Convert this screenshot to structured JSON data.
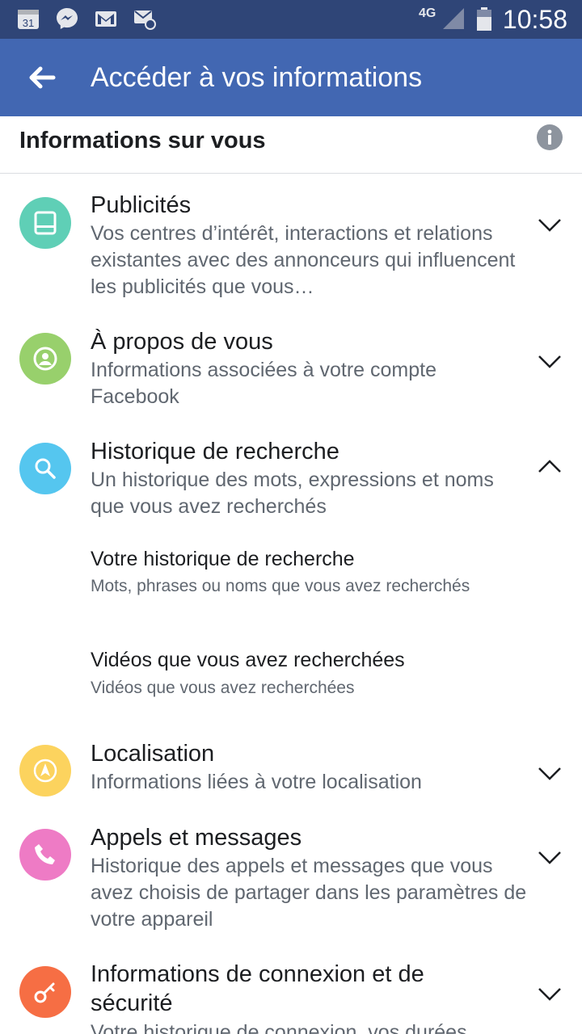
{
  "status_bar": {
    "time": "10:58",
    "network": "4G",
    "icons": [
      "calendar-icon",
      "messenger-icon",
      "mail-icon",
      "email-icon",
      "signal-icon",
      "battery-icon"
    ],
    "calendar_day": "31"
  },
  "app_bar": {
    "title": "Accéder à vos informations",
    "back_icon": "arrow-left-icon",
    "background": "#4267b2"
  },
  "section": {
    "title": "Informations sur vous",
    "info_icon": "info-icon"
  },
  "categories": [
    {
      "title": "Publicités",
      "description": "Vos centres d’intérêt, interactions et relations existantes avec des annonceurs qui influencent les publicités que vous…",
      "icon": "ads-icon",
      "color": "#5fcfb6",
      "expanded": false
    },
    {
      "title": "À propos de vous",
      "description": "Informations associées à votre compte Facebook",
      "icon": "person-icon",
      "color": "#98d06c",
      "expanded": false
    },
    {
      "title": "Historique de recherche",
      "description": "Un historique des mots, expressions et noms que vous avez recherchés",
      "icon": "search-icon",
      "color": "#55c6ef",
      "expanded": true,
      "subitems": [
        {
          "title": "Votre historique de recherche",
          "description": "Mots, phrases ou noms que vous avez recherchés"
        },
        {
          "title": "Vidéos que vous avez recherchées",
          "description": "Vidéos que vous avez recherchées"
        }
      ]
    },
    {
      "title": "Localisation",
      "description": "Informations liées à votre localisation",
      "icon": "location-icon",
      "color": "#fcd35e",
      "expanded": false
    },
    {
      "title": "Appels et messages",
      "description": "Historique des appels et messages que vous avez choisis de partager dans les paramètres de votre appareil",
      "icon": "phone-icon",
      "color": "#ee7bc5",
      "expanded": false
    },
    {
      "title": "Informations de connexion et de sécurité",
      "description": "Votre historique de connexion, vos durées",
      "icon": "key-icon",
      "color": "#f66e44",
      "expanded": false
    }
  ]
}
